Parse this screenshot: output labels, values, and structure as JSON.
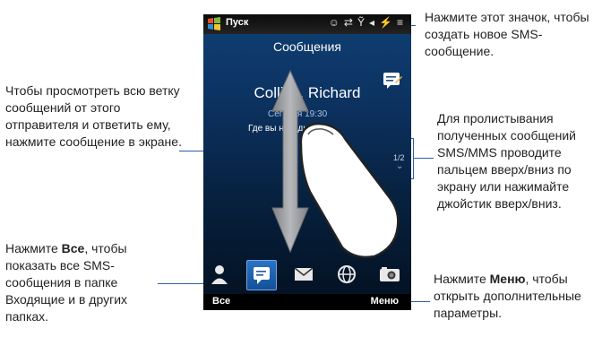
{
  "phone": {
    "start_label": "Пуск",
    "title": "Сообщения",
    "sender": "Collins, Richard",
    "time": "Сегодня 19:30",
    "preview": "Где вы находитесь?",
    "pager": "1/2",
    "softkey_left": "Все",
    "softkey_right": "Меню"
  },
  "callouts": {
    "new_sms": "Нажмите этот значок, чтобы создать новое SMS-сообщение.",
    "thread": "Чтобы просмотреть всю ветку сообщений от этого отправителя и ответить ему, нажмите сообщение в экране.",
    "scroll": "Для пролистывания полученных сообщений SMS/MMS проводите пальцем вверх/вниз по экрану или нажимайте джойстик вверх/вниз.",
    "all_pre": "Нажмите ",
    "all_bold": "Все",
    "all_post": ", чтобы показать все SMS-сообщения в папке Входящие и в других папках.",
    "menu_pre": "Нажмите ",
    "menu_bold": "Меню",
    "menu_post": ", чтобы открыть дополнительные параметры."
  },
  "colors": {
    "accent": "#2a5fa8",
    "screen_top": "#0f3f74",
    "screen_bottom": "#03101f"
  }
}
